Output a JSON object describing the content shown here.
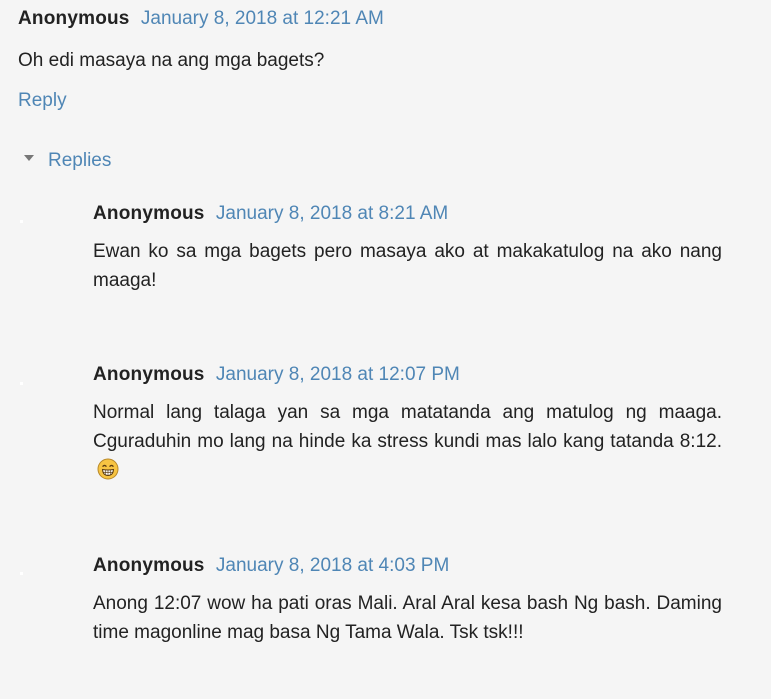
{
  "top_comment": {
    "author": "Anonymous",
    "timestamp": "January 8, 2018 at 12:21 AM",
    "body": "Oh edi masaya na ang mga bagets?",
    "reply_label": "Reply"
  },
  "replies_toggle_label": "Replies",
  "replies": [
    {
      "author": "Anonymous",
      "timestamp": "January 8, 2018 at 8:21 AM",
      "body": "Ewan ko sa mga bagets pero masaya ako at makakatulog na ako nang maaga!"
    },
    {
      "author": "Anonymous",
      "timestamp": "January 8, 2018 at 12:07 PM",
      "body": "Normal lang talaga yan sa mga matatanda ang matulog ng maaga. Cguraduhin mo lang na hinde ka stress kundi mas lalo kang tatanda 8:12.",
      "emoji": "grinning-face-icon"
    },
    {
      "author": "Anonymous",
      "timestamp": "January 8, 2018 at 4:03 PM",
      "body": "Anong 12:07 wow ha pati oras Mali. Aral Aral kesa bash Ng bash. Daming time magonline mag basa Ng Tama Wala. Tsk tsk!!!"
    }
  ],
  "colors": {
    "link": "#4f86b5",
    "text": "#222222",
    "background": "#f5f5f5"
  }
}
